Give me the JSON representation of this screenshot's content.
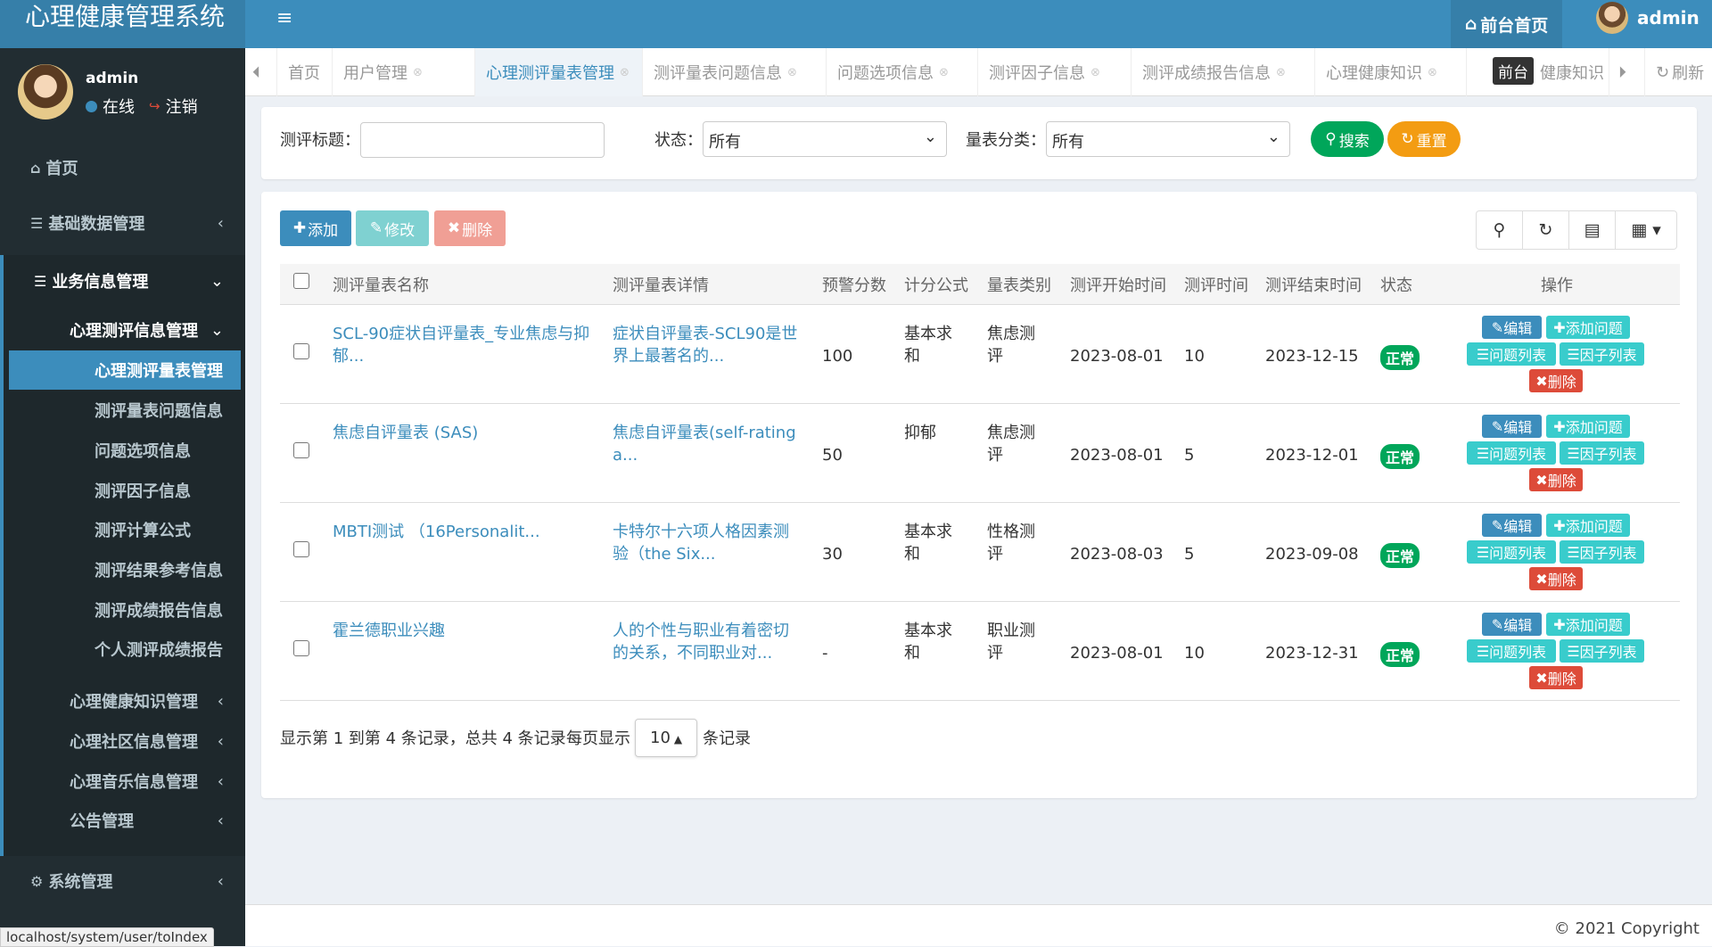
{
  "header": {
    "app_title": "心理健康管理系统",
    "menu_toggle": "≡",
    "front_page": "前台首页",
    "admin": "admin"
  },
  "sidebar": {
    "user": {
      "name": "admin",
      "online": "在线",
      "logout": "注销"
    },
    "home": "首页",
    "basic": "基础数据管理",
    "business": "业务信息管理",
    "assessment": "心理测评信息管理",
    "sub_items": [
      "心理测评量表管理",
      "测评量表问题信息",
      "问题选项信息",
      "测评因子信息",
      "测评计算公式",
      "测评结果参考信息",
      "测评成绩报告信息",
      "个人测评成绩报告"
    ],
    "knowledge": "心理健康知识管理",
    "community": "心理社区信息管理",
    "music": "心理音乐信息管理",
    "notice": "公告管理",
    "system": "系统管理"
  },
  "tabs": {
    "items": [
      "首页",
      "用户管理",
      "心理测评量表管理",
      "测评量表问题信息",
      "问题选项信息",
      "测评因子信息",
      "测评成绩报告信息",
      "心理健康知识",
      "健康知识"
    ],
    "tooltip": "前台",
    "refresh": "刷新"
  },
  "search": {
    "title_label": "测评标题：",
    "title_value": "",
    "status_label": "状态：",
    "status_value": "所有",
    "category_label": "量表分类：",
    "category_value": "所有",
    "search_btn": "搜索",
    "reset_btn": "重置"
  },
  "toolbar": {
    "add": "添加",
    "edit": "修改",
    "delete": "删除"
  },
  "table": {
    "headers": [
      "测评量表名称",
      "测评量表详情",
      "预警分数",
      "计分公式",
      "量表类别",
      "测评开始时间",
      "测评时间",
      "测评结束时间",
      "状态",
      "操作"
    ],
    "rows": [
      {
        "name1": "SCL-90症状自评量表_专业焦虑与抑",
        "name2": "郁...",
        "detail1": "症状自评量表-SCL90是世",
        "detail2": "界上最著名的...",
        "score": "100",
        "formula1": "基本求",
        "formula2": "和",
        "cat1": "焦虑测",
        "cat2": "评",
        "start": "2023-08-01",
        "time": "10",
        "end": "2023-12-15",
        "status": "正常"
      },
      {
        "name1": "焦虑自评量表 (SAS)",
        "name2": "",
        "detail1": "焦虑自评量表(self-rating",
        "detail2": "a...",
        "score": "50",
        "formula1": "抑郁",
        "formula2": "",
        "cat1": "焦虑测",
        "cat2": "评",
        "start": "2023-08-01",
        "time": "5",
        "end": "2023-12-01",
        "status": "正常"
      },
      {
        "name1": "MBTI测试 （16Personalit...",
        "name2": "",
        "detail1": "卡特尔十六项人格因素测",
        "detail2": "验（the Six...",
        "score": "30",
        "formula1": "基本求",
        "formula2": "和",
        "cat1": "性格测",
        "cat2": "评",
        "start": "2023-08-03",
        "time": "5",
        "end": "2023-09-08",
        "status": "正常"
      },
      {
        "name1": "霍兰德职业兴趣",
        "name2": "",
        "detail1": "人的个性与职业有着密切",
        "detail2": "的关系，不同职业对...",
        "score": "-",
        "formula1": "基本求",
        "formula2": "和",
        "cat1": "职业测",
        "cat2": "评",
        "start": "2023-08-01",
        "time": "10",
        "end": "2023-12-31",
        "status": "正常"
      }
    ],
    "ops": {
      "edit": "编辑",
      "add_q": "添加问题",
      "q_list": "问题列表",
      "f_list": "因子列表",
      "del": "删除"
    }
  },
  "pagination": {
    "info": "显示第 1 到第 4 条记录，总共 4 条记录",
    "per_page_prefix": "每页显示",
    "per_page": "10",
    "per_page_suffix": "条记录"
  },
  "footer": {
    "copyright": "© 2021 Copyright"
  },
  "statusbar": {
    "url": "localhost/system/user/toIndex"
  },
  "colors": {
    "primary": "#3c8dbc",
    "sidebar": "#222d32",
    "success": "#00a65a",
    "danger": "#dd4b39",
    "teal": "#39cccc",
    "warning": "#f39c12"
  }
}
